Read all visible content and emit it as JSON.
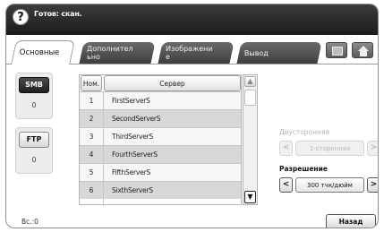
{
  "status": {
    "text": "Готов: скан."
  },
  "tabs": [
    {
      "label": "Основные"
    },
    {
      "label": "Дополнител\nьно"
    },
    {
      "label": "Изображени\nе"
    },
    {
      "label": "Вывод"
    }
  ],
  "protocols": [
    {
      "label": "SMB",
      "count": "0",
      "selected": true
    },
    {
      "label": "FTP",
      "count": "0",
      "selected": false
    }
  ],
  "table": {
    "headers": {
      "num": "Ном.",
      "server": "Сервер"
    },
    "rows": [
      {
        "num": "1",
        "name": "FirstServerS"
      },
      {
        "num": "2",
        "name": "SecondServerS"
      },
      {
        "num": "3",
        "name": "ThirdServerS"
      },
      {
        "num": "4",
        "name": "FourthServerS"
      },
      {
        "num": "5",
        "name": "FifthServerS"
      },
      {
        "num": "6",
        "name": "SixthServerS"
      }
    ]
  },
  "duplex": {
    "label": "Двусторонняя",
    "value": "1-сторонняя",
    "enabled": false
  },
  "resolution": {
    "label": "Разрешение",
    "value": "300 тчк/дюйм"
  },
  "footer": {
    "total": "Вс.:0",
    "back_label": "Назад"
  },
  "icons": {
    "help": "help-icon",
    "job": "job-status-icon",
    "home": "home-icon"
  },
  "colors": {
    "topbar": "#2a2a2a",
    "tab_inactive": "#555555",
    "row_alt": "#d7d7d7"
  }
}
